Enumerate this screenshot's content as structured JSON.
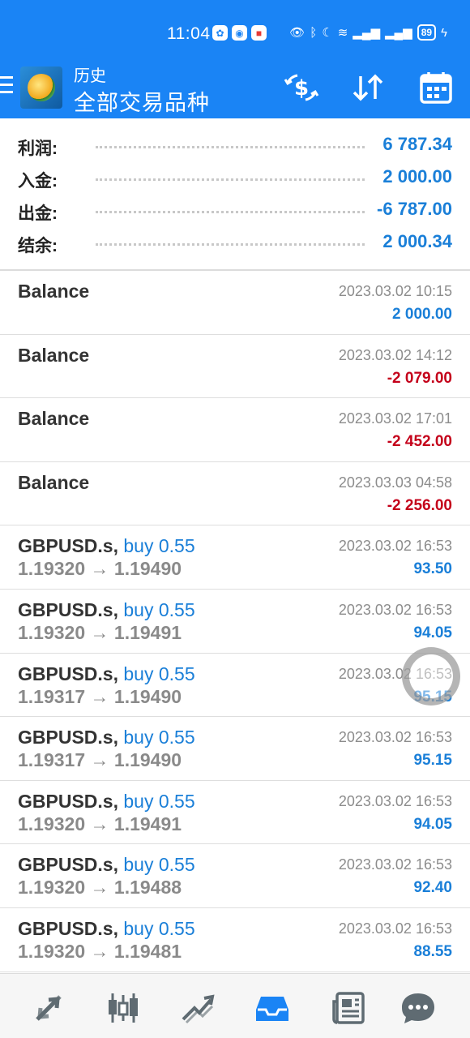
{
  "status_bar": {
    "time": "11:04",
    "battery": "89",
    "notif_icons": [
      "app-icon-1",
      "app-icon-2",
      "app-icon-3"
    ]
  },
  "app_bar": {
    "subtitle": "历史",
    "title": "全部交易品种",
    "actions": [
      "exchange-icon",
      "sort-icon",
      "calendar-icon"
    ],
    "accent_color": "#1a84f5"
  },
  "summary": [
    {
      "label": "利润:",
      "value": "6 787.34"
    },
    {
      "label": "入金:",
      "value": "2 000.00"
    },
    {
      "label": "出金:",
      "value": "-6 787.00"
    },
    {
      "label": "结余:",
      "value": "2 000.34"
    }
  ],
  "rows": [
    {
      "symbol": "Balance",
      "deal": "",
      "prices": "",
      "date": "2023.03.02 10:15",
      "amount": "2 000.00",
      "sign": "pos"
    },
    {
      "symbol": "Balance",
      "deal": "",
      "prices": "",
      "date": "2023.03.02 14:12",
      "amount": "-2 079.00",
      "sign": "neg"
    },
    {
      "symbol": "Balance",
      "deal": "",
      "prices": "",
      "date": "2023.03.02 17:01",
      "amount": "-2 452.00",
      "sign": "neg"
    },
    {
      "symbol": "Balance",
      "deal": "",
      "prices": "",
      "date": "2023.03.03 04:58",
      "amount": "-2 256.00",
      "sign": "neg"
    },
    {
      "symbol": "GBPUSD.s,",
      "deal": "buy 0.55",
      "prices": "1.19320 → 1.19490",
      "date": "2023.03.02 16:53",
      "amount": "93.50",
      "sign": "pos"
    },
    {
      "symbol": "GBPUSD.s,",
      "deal": "buy 0.55",
      "prices": "1.19320 → 1.19491",
      "date": "2023.03.02 16:53",
      "amount": "94.05",
      "sign": "pos"
    },
    {
      "symbol": "GBPUSD.s,",
      "deal": "buy 0.55",
      "prices": "1.19317 → 1.19490",
      "date": "2023.03.02 16:53",
      "amount": "95.15",
      "sign": "pos"
    },
    {
      "symbol": "GBPUSD.s,",
      "deal": "buy 0.55",
      "prices": "1.19317 → 1.19490",
      "date": "2023.03.02 16:53",
      "amount": "95.15",
      "sign": "pos"
    },
    {
      "symbol": "GBPUSD.s,",
      "deal": "buy 0.55",
      "prices": "1.19320 → 1.19491",
      "date": "2023.03.02 16:53",
      "amount": "94.05",
      "sign": "pos"
    },
    {
      "symbol": "GBPUSD.s,",
      "deal": "buy 0.55",
      "prices": "1.19320 → 1.19488",
      "date": "2023.03.02 16:53",
      "amount": "92.40",
      "sign": "pos"
    },
    {
      "symbol": "GBPUSD.s,",
      "deal": "buy 0.55",
      "prices": "1.19320 → 1.19481",
      "date": "2023.03.02 16:53",
      "amount": "88.55",
      "sign": "pos"
    }
  ],
  "bottom_nav": {
    "items": [
      "quotes-icon",
      "chart-icon",
      "trade-icon",
      "history-icon",
      "news-icon",
      "chat-icon"
    ],
    "active": "history-icon",
    "active_color": "#1a84f5"
  }
}
